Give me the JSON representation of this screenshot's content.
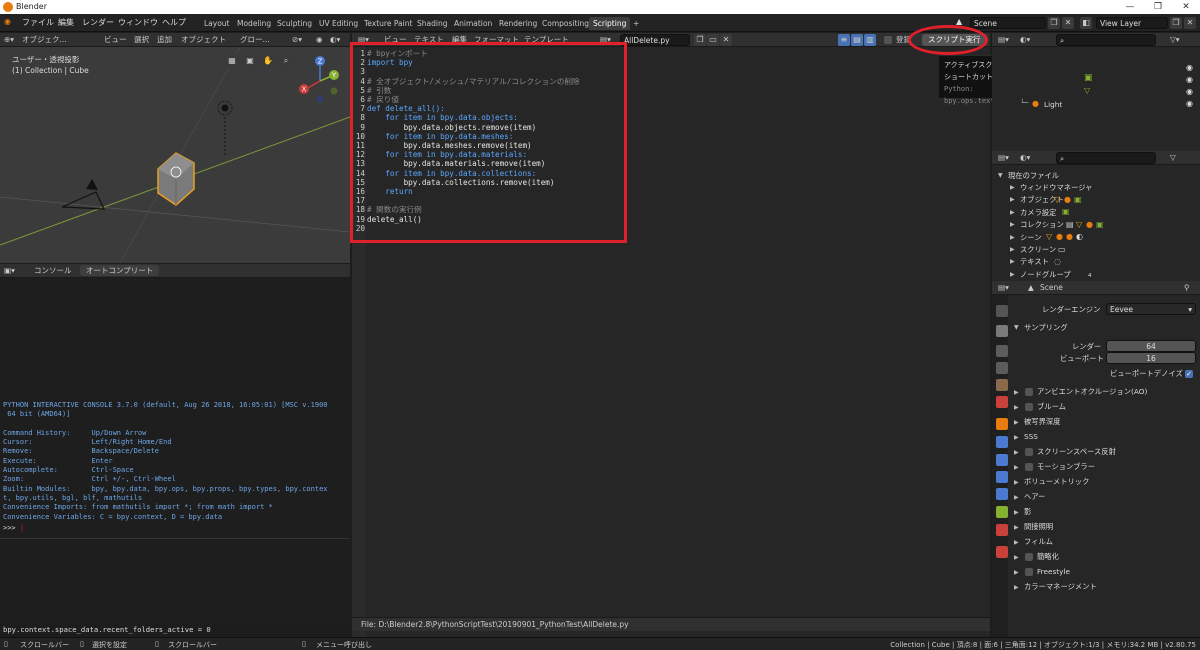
{
  "window": {
    "title": "Blender",
    "controls": [
      "—",
      "❐",
      "✕"
    ]
  },
  "menus": [
    "ファイル",
    "編集",
    "レンダー",
    "ウィンドウ",
    "ヘルプ"
  ],
  "workspaces": [
    "Layout",
    "Modeling",
    "Sculpting",
    "UV Editing",
    "Texture Paint",
    "Shading",
    "Animation",
    "Rendering",
    "Compositing",
    "Scripting",
    "+"
  ],
  "scene": {
    "name": "Scene",
    "view_layer": "View Layer"
  },
  "viewport": {
    "header_items": [
      "オブジェク...",
      "ビュー",
      "選択",
      "追加",
      "オブジェクト",
      "グロー..."
    ],
    "title": "ユーザー・透視投影",
    "subtitle": "(1) Collection | Cube",
    "gizmo": {
      "z": "Z",
      "y": "Y",
      "x": "X"
    }
  },
  "console": {
    "tabs": [
      "コンソール",
      "オートコンプリート"
    ],
    "lines": [
      "PYTHON INTERACTIVE CONSOLE 3.7.0 (default, Aug 26 2018, 16:05:01) [MSC v.1900",
      " 64 bit (AMD64)]",
      "",
      "Command History:     Up/Down Arrow",
      "Cursor:              Left/Right Home/End",
      "Remove:              Backspace/Delete",
      "Execute:             Enter",
      "Autocomplete:        Ctrl-Space",
      "Zoom:                Ctrl +/-, Ctrl-Wheel",
      "Builtin Modules:     bpy, bpy.data, bpy.ops, bpy.props, bpy.types, bpy.contex",
      "t, bpy.utils, bgl, blf, mathutils",
      "Convenience Imports: from mathutils import *; from math import *",
      "Convenience Variables: C = bpy.context, D = bpy.data"
    ],
    "prompt": ">>> ",
    "info_line": "bpy.context.space_data.recent_folders_active = 0"
  },
  "editor": {
    "header_items": [
      "ビュー",
      "テキスト",
      "編集",
      "フォーマット",
      "テンプレート"
    ],
    "filename": "AllDelete.py",
    "register_label": "登録",
    "run_button": "スクリプト実行",
    "filepath": "File: D:\\Blender2.8\\PythonScriptTest\\20190901_PythonTest\\AllDelete.py",
    "code": [
      {
        "n": "1",
        "t": "# bpyインポート"
      },
      {
        "n": "2",
        "t": "import bpy"
      },
      {
        "n": "3",
        "t": ""
      },
      {
        "n": "4",
        "t": "# 全オブジェクト/メッシュ/マテリアル/コレクションの削除"
      },
      {
        "n": "5",
        "t": "# 引数"
      },
      {
        "n": "6",
        "t": "# 戻り値"
      },
      {
        "n": "7",
        "t": "def delete_all():"
      },
      {
        "n": "8",
        "t": "    for item in bpy.data.objects:"
      },
      {
        "n": "9",
        "t": "        bpy.data.objects.remove(item)"
      },
      {
        "n": "10",
        "t": "    for item in bpy.data.meshes:"
      },
      {
        "n": "11",
        "t": "        bpy.data.meshes.remove(item)"
      },
      {
        "n": "12",
        "t": "    for item in bpy.data.materials:"
      },
      {
        "n": "13",
        "t": "        bpy.data.materials.remove(item)"
      },
      {
        "n": "14",
        "t": "    for item in bpy.data.collections:"
      },
      {
        "n": "15",
        "t": "        bpy.data.collections.remove(item)"
      },
      {
        "n": "16",
        "t": "    return"
      },
      {
        "n": "17",
        "t": ""
      },
      {
        "n": "18",
        "t": "# 関数の実行例"
      },
      {
        "n": "19",
        "t": "delete_all()"
      },
      {
        "n": "20",
        "t": ""
      }
    ]
  },
  "tooltip": {
    "line1": "アクティブスクリプトを実行します。",
    "line2": "ショートカット:[Alt] P",
    "line3": "Python: bpy.ops.text.run_script()"
  },
  "outliner": {
    "light": "Light"
  },
  "datablocks": {
    "root": "現在のファイル",
    "items": [
      "ウィンドウマネージャ",
      "オブジェクト",
      "カメラ設定",
      "コレクション",
      "シーン",
      "スクリーン",
      "テキスト",
      "ノードグループ"
    ],
    "node_count": "4"
  },
  "properties": {
    "context": "Scene",
    "render_engine_label": "レンダーエンジン",
    "render_engine": "Eevee",
    "sampling": "サンプリング",
    "render_label": "レンダー",
    "render_samples": "64",
    "viewport_label": "ビューポート",
    "viewport_samples": "16",
    "denoise_label": "ビューポートデノイズ",
    "panels": [
      {
        "label": "アンビエントオクルージョン(AO)",
        "check": true
      },
      {
        "label": "ブルーム",
        "check": true
      },
      {
        "label": "被写界深度",
        "check": false
      },
      {
        "label": "SSS",
        "check": false
      },
      {
        "label": "スクリーンスペース反射",
        "check": true
      },
      {
        "label": "モーションブラー",
        "check": true
      },
      {
        "label": "ボリューメトリック",
        "check": false
      },
      {
        "label": "ヘアー",
        "check": false
      },
      {
        "label": "影",
        "check": false
      },
      {
        "label": "間接照明",
        "check": false
      },
      {
        "label": "フィルム",
        "check": false
      },
      {
        "label": "簡略化",
        "check": true
      },
      {
        "label": "Freestyle",
        "check": true
      },
      {
        "label": "カラーマネージメント",
        "check": false
      }
    ]
  },
  "status": {
    "left": [
      "スクロールバー",
      "選択を設定",
      "スクロールバー",
      "メニュー呼び出し"
    ],
    "right": "Collection | Cube | 頂点:8 | 面:6 | 三角面:12 | オブジェクト:1/3 | メモリ:34.2 MB | v2.80.75"
  },
  "colors": {
    "accent_orange": "#e87d0d",
    "active_blue": "#4772b3",
    "annotation_red": "#e0202a",
    "keyword": "#5aa7ff"
  }
}
